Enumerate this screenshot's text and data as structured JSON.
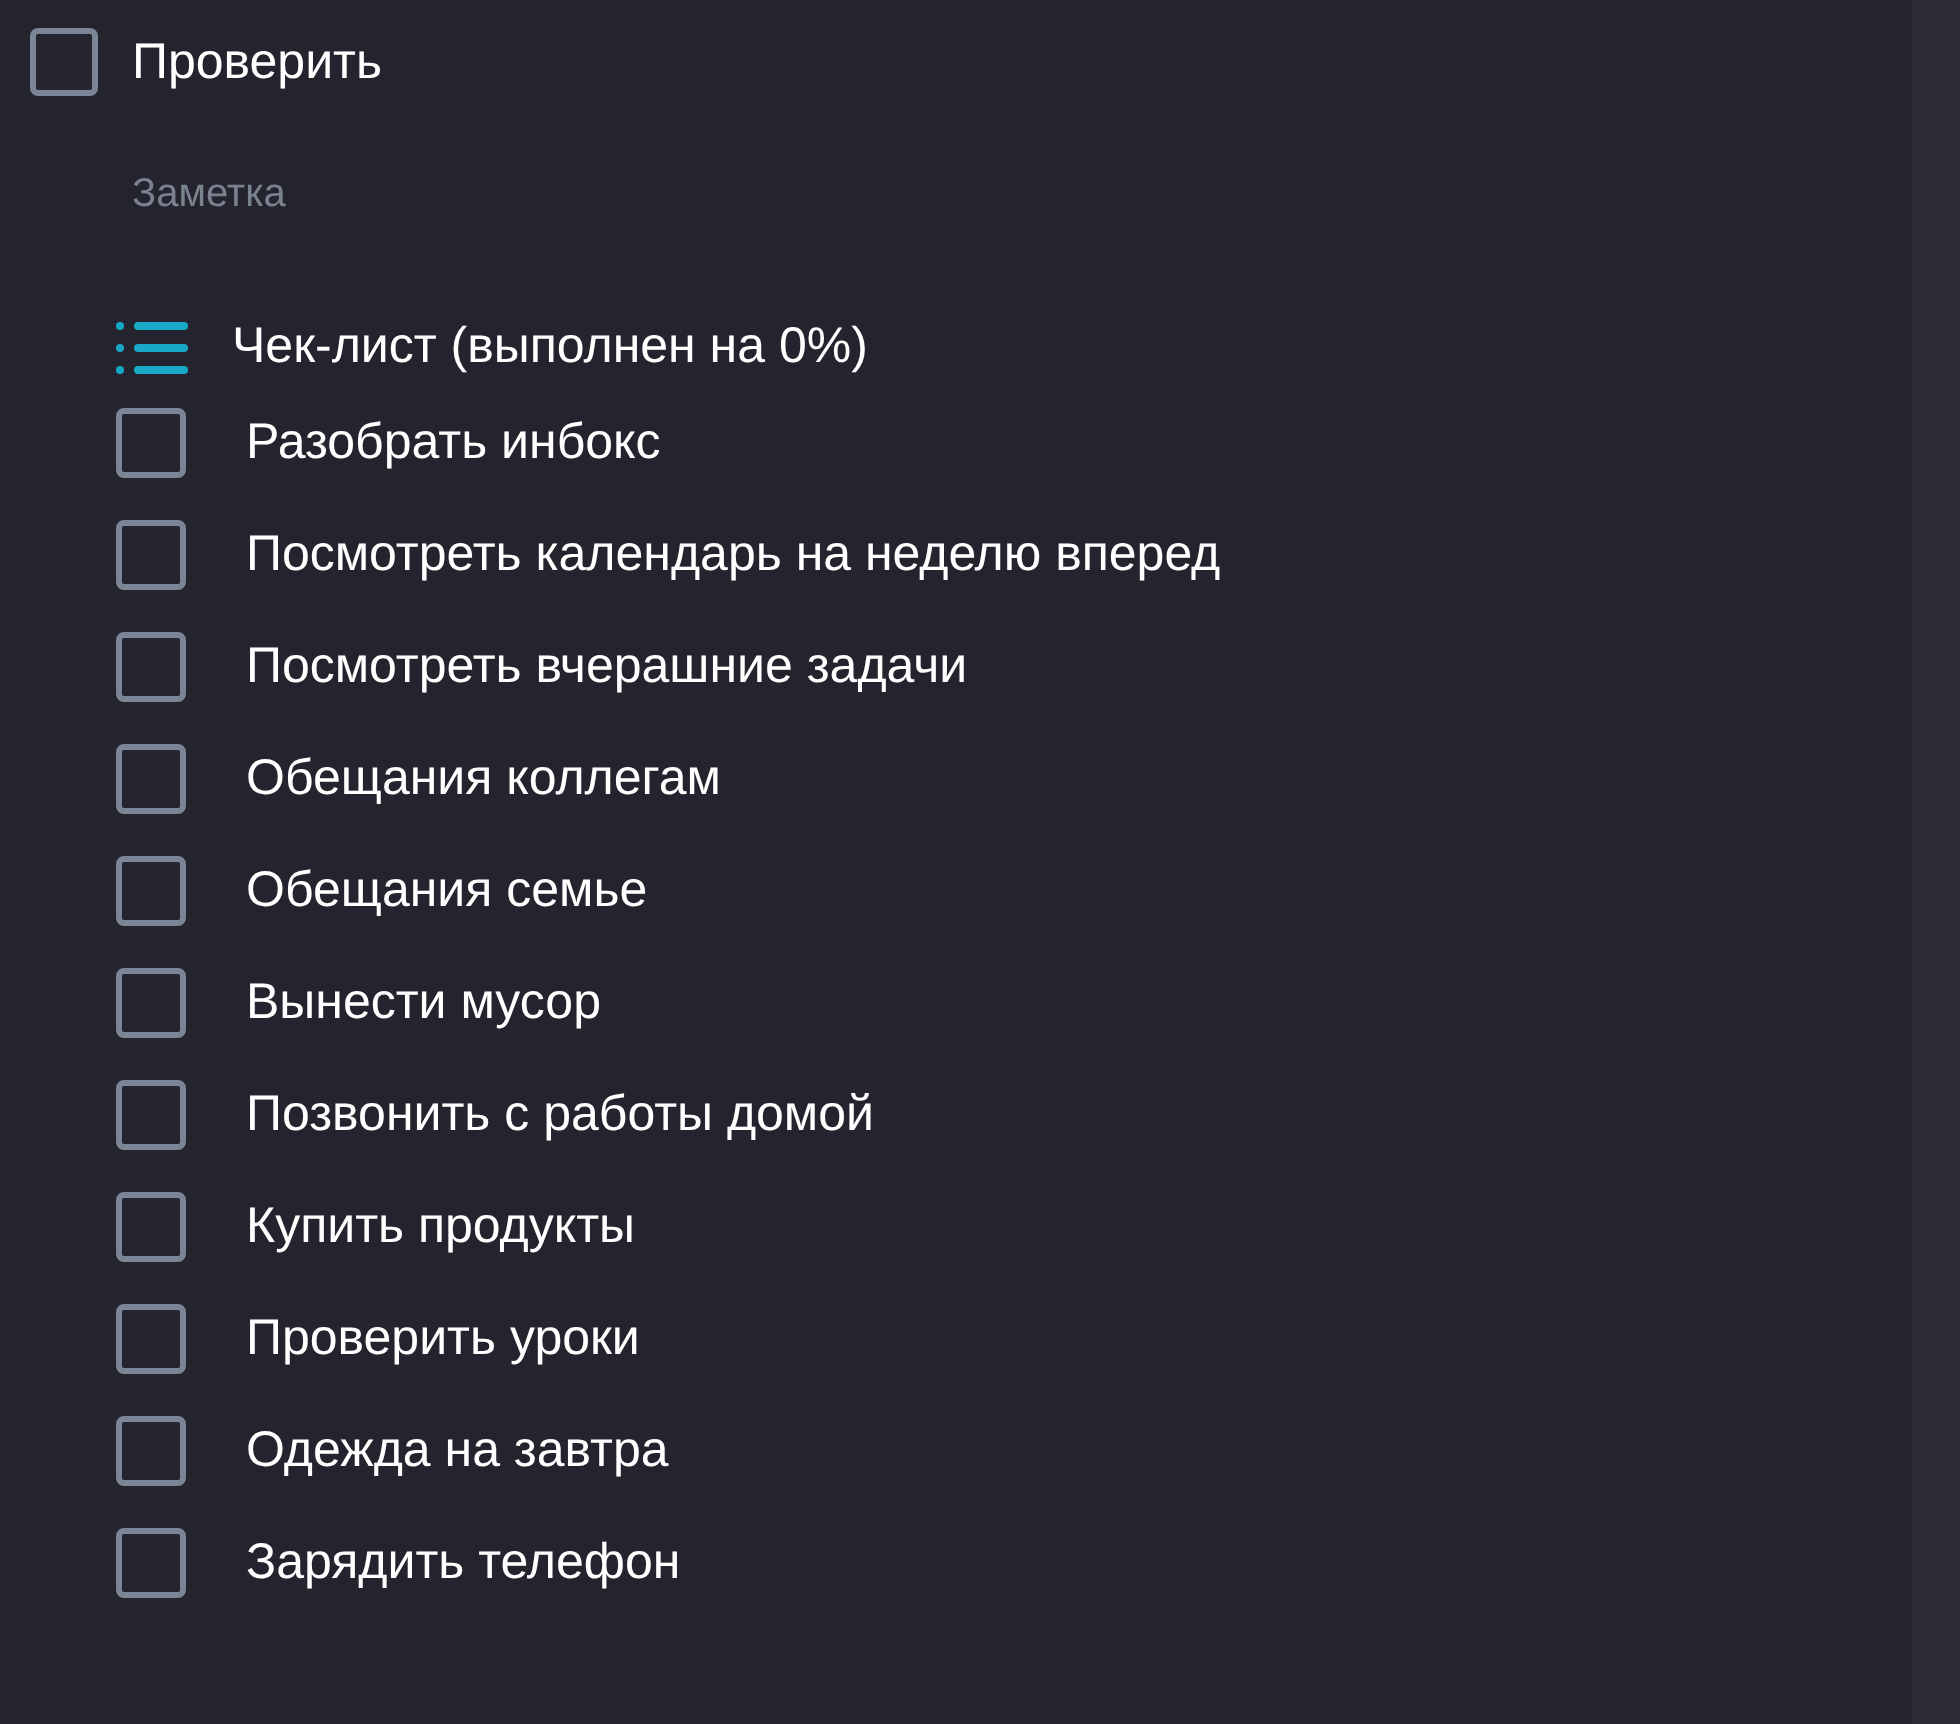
{
  "task": {
    "title": "Проверить",
    "checked": false
  },
  "note": {
    "placeholder": "Заметка"
  },
  "checklist": {
    "title": "Чек-лист (выполнен на 0%)",
    "items": [
      {
        "label": "Разобрать инбокс",
        "checked": false
      },
      {
        "label": "Посмотреть календарь на неделю вперед",
        "checked": false
      },
      {
        "label": "Посмотреть вчерашние задачи",
        "checked": false
      },
      {
        "label": "Обещания коллегам",
        "checked": false
      },
      {
        "label": "Обещания семье",
        "checked": false
      },
      {
        "label": "Вынести мусор",
        "checked": false
      },
      {
        "label": "Позвонить с работы домой",
        "checked": false
      },
      {
        "label": "Купить продукты",
        "checked": false
      },
      {
        "label": "Проверить уроки",
        "checked": false
      },
      {
        "label": "Одежда на завтра",
        "checked": false
      },
      {
        "label": "Зарядить телефон",
        "checked": false
      }
    ]
  }
}
